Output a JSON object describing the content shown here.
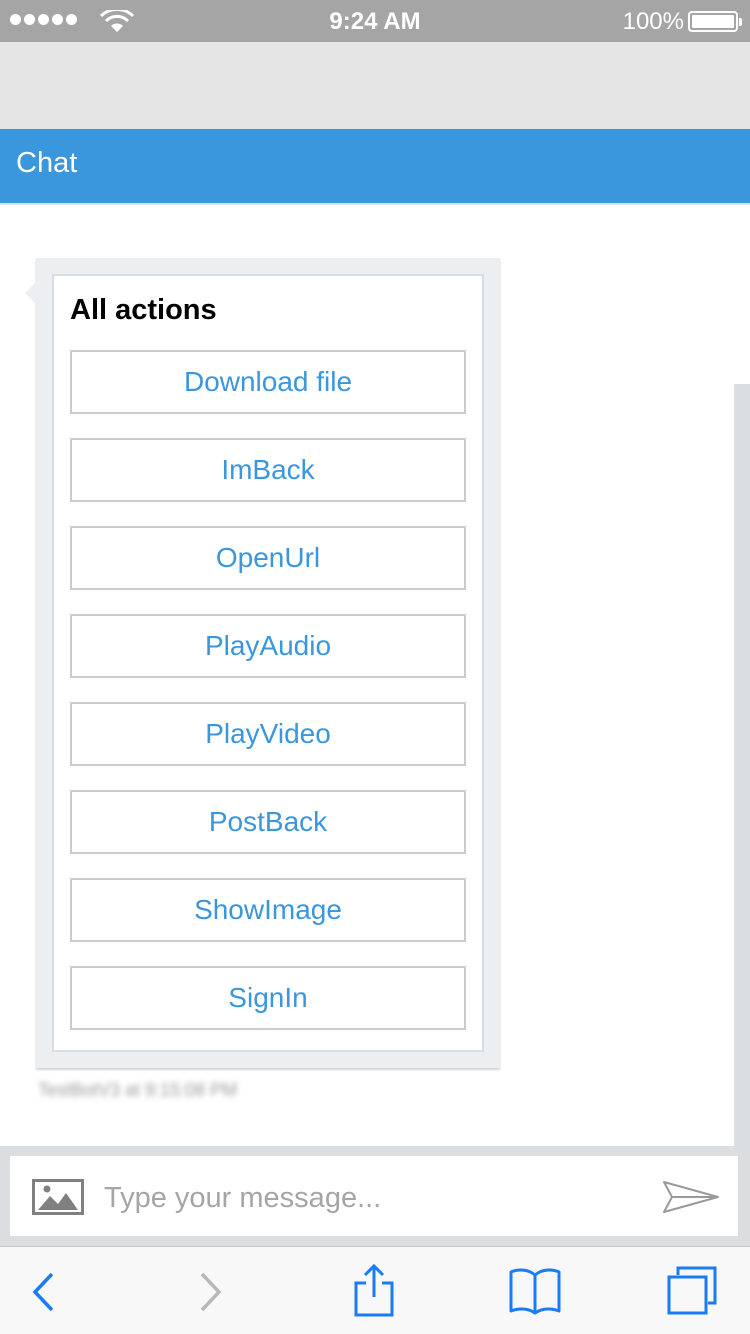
{
  "status_bar": {
    "time": "9:24 AM",
    "battery_percent": "100%",
    "icons": [
      "signal-dots-icon",
      "wifi-icon",
      "battery-icon"
    ]
  },
  "header": {
    "title": "Chat"
  },
  "message": {
    "card_title": "All actions",
    "actions": [
      {
        "label": "Download file"
      },
      {
        "label": "ImBack"
      },
      {
        "label": "OpenUrl"
      },
      {
        "label": "PlayAudio"
      },
      {
        "label": "PlayVideo"
      },
      {
        "label": "PostBack"
      },
      {
        "label": "ShowImage"
      },
      {
        "label": "SignIn"
      }
    ],
    "timestamp": "TestBotV3 at 9:15:08 PM"
  },
  "composer": {
    "placeholder": "Type your message...",
    "icons": [
      "image-upload-icon",
      "send-icon"
    ]
  },
  "toolbar": {
    "icons": [
      "back-icon",
      "forward-icon",
      "share-icon",
      "bookmarks-icon",
      "tabs-icon"
    ]
  },
  "colors": {
    "accent": "#3a96dd",
    "status_bar": "#a5a5a5",
    "bubble": "#eceff1"
  }
}
